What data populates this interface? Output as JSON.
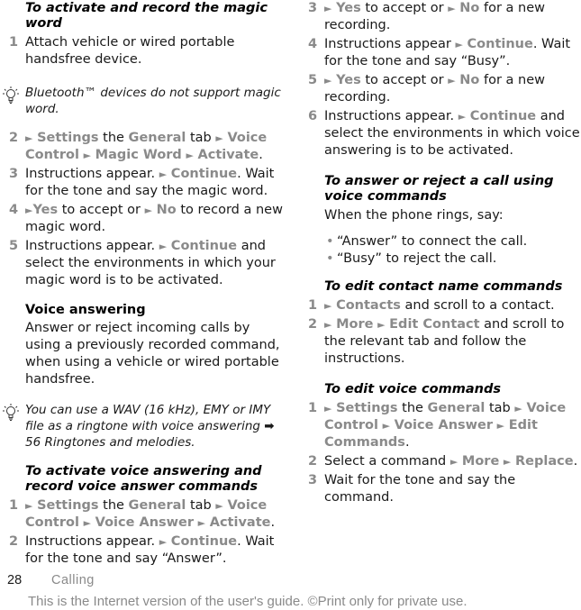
{
  "left": {
    "proc1_title": "To activate and record the magic word",
    "proc1_step1": {
      "num": "1",
      "text": "Attach vehicle or wired portable handsfree device."
    },
    "tip1": "Bluetooth™  devices do not support magic word.",
    "proc1_step2": {
      "num": "2",
      "nav1": "Settings",
      "t1": " the ",
      "nav2": "General",
      "t2": " tab ",
      "nav3": "Voice Control",
      "nav4": "Magic Word",
      "nav5": "Activate",
      "t3": "."
    },
    "proc1_step3": {
      "num": "3",
      "t1": "Instructions appear. ",
      "nav1": "Continue",
      "t2": ". Wait for the tone and say the magic word."
    },
    "proc1_step4": {
      "num": "4",
      "nav1": "Yes",
      "t1": " to accept or ",
      "nav2": "No",
      "t2": " to record a new magic word."
    },
    "proc1_step5": {
      "num": "5",
      "t1": "Instructions appear. ",
      "nav1": "Continue",
      "t2": " and select the environments in which your magic word is to be activated."
    },
    "section_title": "Voice answering",
    "section_para": "Answer or reject incoming calls by using a previously recorded command, when using a vehicle or wired portable handsfree.",
    "tip2": {
      "text": "You can use a WAV (16 kHz), EMY or IMY file as a ringtone with voice answering ",
      "pointer": "➡",
      "ref": " 56 Ringtones and melodies."
    },
    "proc2_title": "To activate voice answering and record voice answer commands",
    "proc2_step1": {
      "num": "1",
      "nav1": "Settings",
      "t1": " the ",
      "nav2": "General",
      "t2": " tab ",
      "nav3": "Voice Control",
      "nav4": "Voice Answer",
      "nav5": "Activate",
      "t3": "."
    },
    "proc2_step2": {
      "num": "2",
      "t1": "Instructions appear. ",
      "nav1": "Continue",
      "t2": ". Wait for the tone and say “Answer”."
    }
  },
  "right": {
    "proc2_step3": {
      "num": "3",
      "nav1": "Yes",
      "t1": " to accept or ",
      "nav2": "No",
      "t2": " for a new recording."
    },
    "proc2_step4": {
      "num": "4",
      "t1": "Instructions appear ",
      "nav1": "Continue",
      "t2": ". Wait for the tone and say “Busy”."
    },
    "proc2_step5": {
      "num": "5",
      "nav1": "Yes",
      "t1": " to accept or ",
      "nav2": "No",
      "t2": " for a new recording."
    },
    "proc2_step6": {
      "num": "6",
      "t1": "Instructions appear. ",
      "nav1": "Continue",
      "t2": " and select the environments in which voice answering is to be activated."
    },
    "proc3_title": "To answer or reject a call using voice commands",
    "proc3_intro": "When the phone rings, say:",
    "proc3_bullets": [
      "“Answer” to connect the call.",
      "“Busy” to reject the call."
    ],
    "proc4_title": "To edit contact name commands",
    "proc4_step1": {
      "num": "1",
      "nav1": "Contacts",
      "t1": " and scroll to a contact."
    },
    "proc4_step2": {
      "num": "2",
      "nav1": "More",
      "nav2": "Edit Contact",
      "t1": " and scroll to the relevant tab and follow the instructions."
    },
    "proc5_title": "To edit voice commands",
    "proc5_step1": {
      "num": "1",
      "nav1": "Settings",
      "t1": " the ",
      "nav2": "General",
      "t2": " tab ",
      "nav3": "Voice Control",
      "nav4": "Voice Answer",
      "nav5": "Edit Commands",
      "t3": "."
    },
    "proc5_step2": {
      "num": "2",
      "t1": "Select a command ",
      "nav1": "More",
      "nav2": "Replace",
      "t2": "."
    },
    "proc5_step3": {
      "num": "3",
      "t1": "Wait for the tone and say the command."
    }
  },
  "footer": {
    "page_number": "28",
    "section": "Calling",
    "note": "This is the Internet version of the user's guide. ©Print only for private use."
  },
  "symbols": {
    "arrow": "►",
    "bullet": "•"
  }
}
